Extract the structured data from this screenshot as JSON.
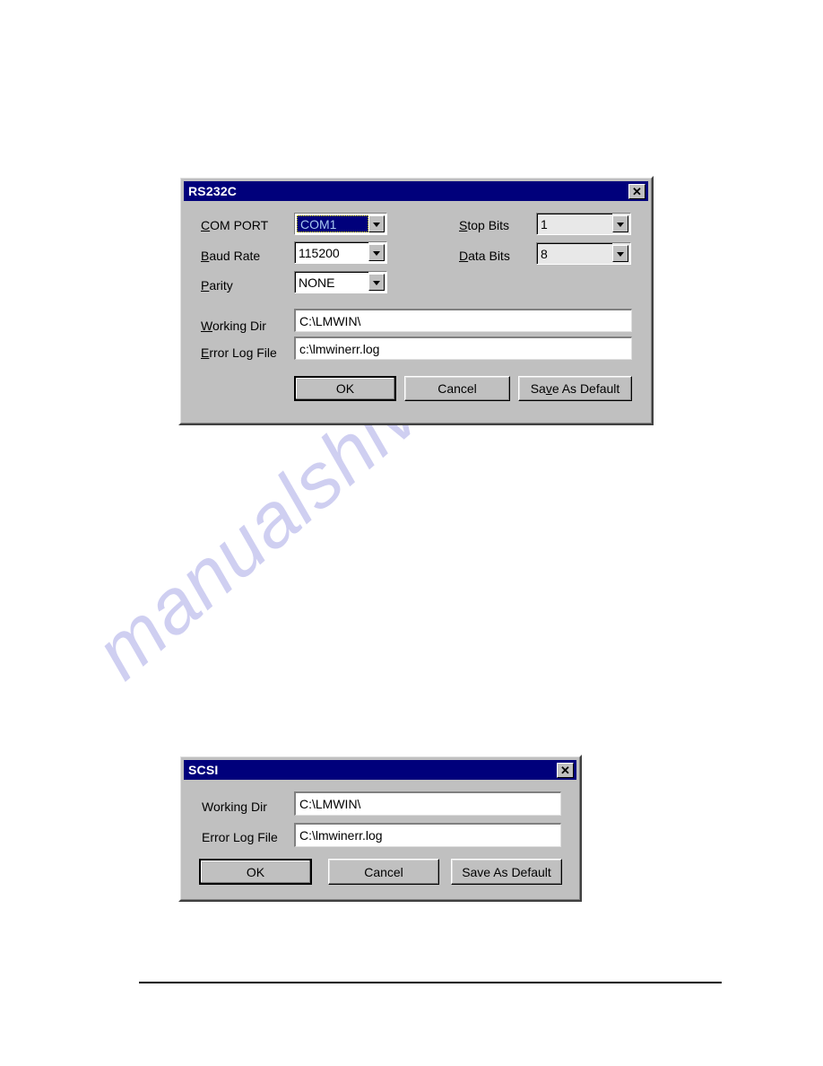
{
  "page": {
    "watermark_text": "manualshive.com",
    "background_color": "#ffffff",
    "footer_rule": true
  },
  "theme": {
    "dialog_face": "#c0c0c0",
    "titlebar_color": "#00007b",
    "titlebar_text_color": "#ffffff",
    "selection_bg": "#00007b",
    "selection_text": "#a8c8f0",
    "watermark_color": "#ccccf0"
  },
  "rs232c_dialog": {
    "title": "RS232C",
    "close_icon": "close-icon",
    "close_glyph": "✕",
    "fields": {
      "com_port": {
        "label_pre": "",
        "label_acc": "C",
        "label_post": "OM PORT",
        "label_full": "COM PORT",
        "value": "COM1",
        "focused": true,
        "arrow_icon": "chevron-down-icon"
      },
      "baud_rate": {
        "label_acc": "B",
        "label_post": "aud Rate",
        "label_full": "Baud Rate",
        "value": "115200",
        "focused": false,
        "arrow_icon": "chevron-down-icon"
      },
      "parity": {
        "label_acc": "P",
        "label_post": "arity",
        "label_full": "Parity",
        "value": "NONE",
        "focused": false,
        "arrow_icon": "chevron-down-icon"
      },
      "stop_bits": {
        "label_acc": "S",
        "label_post": "top  Bits",
        "label_full": "Stop Bits",
        "value": "1",
        "focused": false,
        "arrow_icon": "chevron-down-icon"
      },
      "data_bits": {
        "label_acc": "D",
        "label_post": "ata Bits",
        "label_full": "Data Bits",
        "value": "8",
        "focused": false,
        "arrow_icon": "chevron-down-icon"
      },
      "working_dir": {
        "label_acc": "W",
        "label_post": "orking  Dir",
        "label_full": "Working Dir",
        "value": "C:\\LMWIN\\"
      },
      "error_log_file": {
        "label_acc": "E",
        "label_post": "rror Log File",
        "label_full": "Error Log File",
        "value": "c:\\lmwinerr.log"
      }
    },
    "buttons": {
      "ok": "OK",
      "cancel": "Cancel",
      "save_as_default_pre": "Sa",
      "save_as_default_acc": "v",
      "save_as_default_post": "e As Default",
      "save_as_default_full": "Save As Default"
    }
  },
  "scsi_dialog": {
    "title": "SCSI",
    "close_icon": "close-icon",
    "close_glyph": "✕",
    "fields": {
      "working_dir": {
        "label": "Working Dir",
        "value": "C:\\LMWIN\\"
      },
      "error_log_file": {
        "label": "Error Log File",
        "value": "C:\\lmwinerr.log"
      }
    },
    "buttons": {
      "ok": "OK",
      "cancel": "Cancel",
      "save_as_default": "Save As Default"
    }
  }
}
